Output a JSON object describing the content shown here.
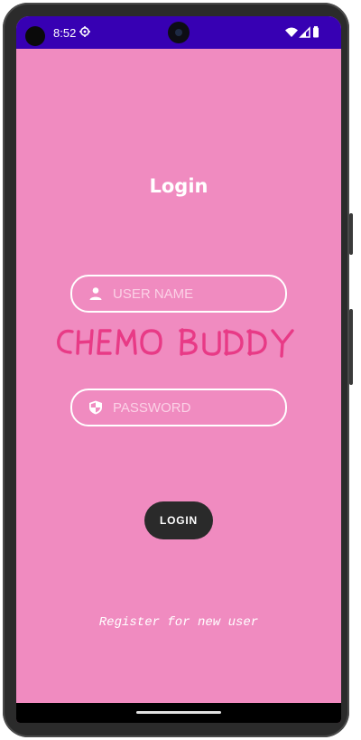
{
  "status_bar": {
    "time": "8:52",
    "background": "#3700b3",
    "icons": [
      "settings-gear-icon",
      "wifi-icon",
      "cellular-signal-icon",
      "battery-icon"
    ]
  },
  "screen": {
    "background": "#f08bc0"
  },
  "login": {
    "title": "Login",
    "username_placeholder": "USER NAME",
    "username_value": "",
    "username_icon": "person-icon",
    "password_placeholder": "PASSWORD",
    "password_value": "",
    "password_icon": "shield-icon",
    "brand_logo_text": "CHEMO BUDDY",
    "brand_logo_color": "#e83a86",
    "button_label": "LOGIN",
    "register_link": "Register for new user"
  }
}
